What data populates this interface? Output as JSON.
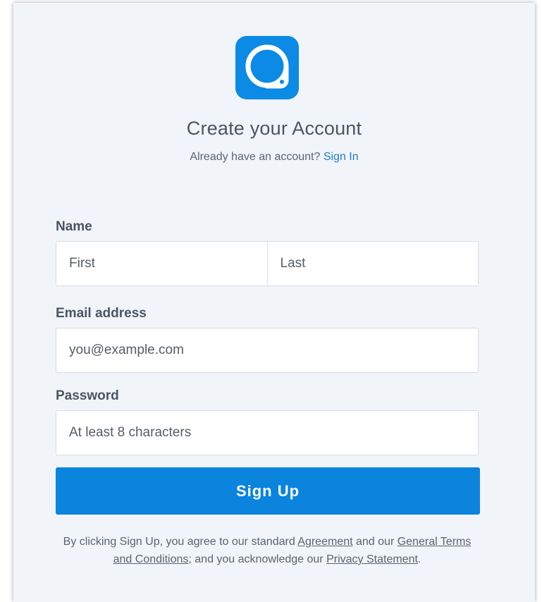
{
  "header": {
    "logo_icon": "app-logo-icon",
    "title": "Create your Account",
    "subtitle_prefix": "Already have an account?",
    "sign_in_label": "Sign In"
  },
  "form": {
    "name": {
      "label": "Name",
      "first_placeholder": "First",
      "last_placeholder": "Last"
    },
    "email": {
      "label": "Email address",
      "placeholder": "you@example.com"
    },
    "password": {
      "label": "Password",
      "placeholder": "At least 8 characters"
    },
    "submit_label": "Sign Up"
  },
  "legal": {
    "text_1": "By clicking Sign Up, you agree to our standard",
    "agreement_link": "Agreement",
    "text_2": "and our",
    "terms_link": "General Terms and Conditions",
    "text_3": "; and you acknowledge our",
    "privacy_link": "Privacy Statement",
    "text_4": "."
  },
  "colors": {
    "accent": "#0b84de",
    "background": "#f1f4f8",
    "link": "#1f7fd1"
  }
}
